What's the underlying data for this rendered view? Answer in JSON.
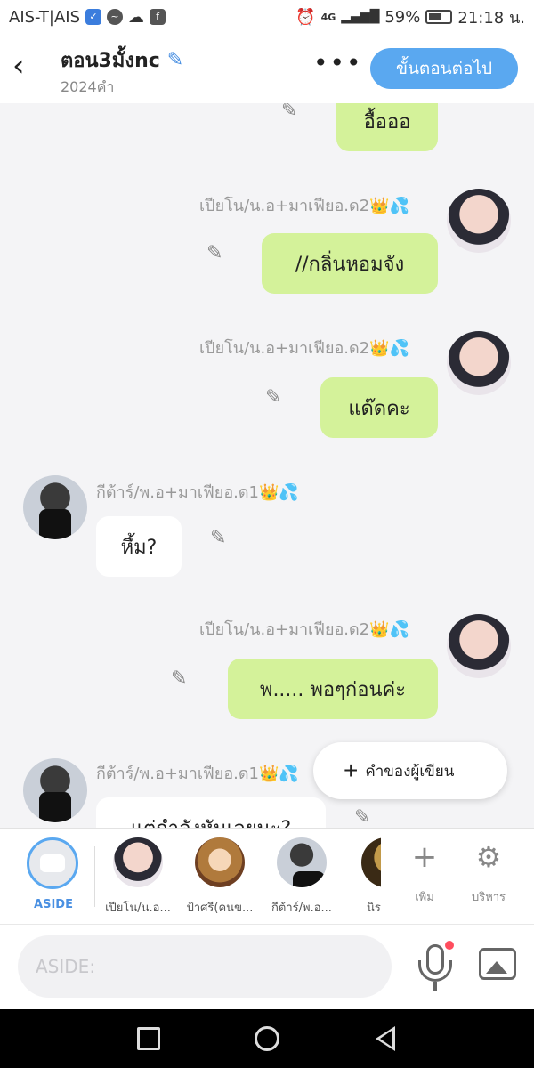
{
  "status_bar": {
    "carrier": "AIS-T|AIS",
    "network": "4G",
    "battery": "59%",
    "time": "21:18 น."
  },
  "header": {
    "title": "ตอน3มั้งnc",
    "word_count": "2024คำ",
    "more_icon": "more-dots-icon",
    "next_button": "ขั้นตอนต่อไป"
  },
  "messages": [
    {
      "side": "right",
      "sender": "",
      "text": "อื้อออ"
    },
    {
      "side": "right",
      "sender": "เปียโน/น.อ+มาเฟียอ.ด2",
      "text": "//กลิ่นหอมจัง"
    },
    {
      "side": "right",
      "sender": "เปียโน/น.อ+มาเฟียอ.ด2",
      "text": "แด๊ดคะ"
    },
    {
      "side": "left",
      "sender": "กีต้าร์/พ.อ+มาเฟียอ.ด1",
      "text": "หึ้ม?"
    },
    {
      "side": "right",
      "sender": "เปียโน/น.อ+มาเฟียอ.ด2",
      "text": "พ..... พอๆก่อนค่ะ"
    },
    {
      "side": "left",
      "sender": "กีต้าร์/พ.อ+มาเฟียอ.ด1",
      "text": "แต่กำลังหันเลยนะ?"
    }
  ],
  "sender_emoji": "👑💦",
  "float_button": "คำของผู้เขียน",
  "strip": {
    "aside_label": "ASIDE",
    "characters": [
      {
        "name": "เปียโน/น.อ..."
      },
      {
        "name": "ป้าศรี(คนข..."
      },
      {
        "name": "กีต้าร์/พ.อ..."
      },
      {
        "name": "นิร"
      }
    ],
    "add_label": "เพิ่ม",
    "manage_label": "บริหาร"
  },
  "input": {
    "placeholder": "ASIDE:"
  },
  "colors": {
    "accent": "#5aa8f0",
    "bubble_green": "#d4f29a",
    "mic_dot": "#ff4d5e"
  }
}
